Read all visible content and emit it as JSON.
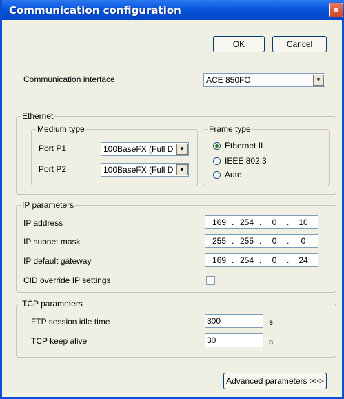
{
  "window": {
    "title": "Communication configuration",
    "close_glyph": "×"
  },
  "buttons": {
    "ok": "OK",
    "cancel": "Cancel",
    "advanced": "Advanced parameters >>>"
  },
  "comm_interface": {
    "label": "Communication interface",
    "value": "ACE 850FO"
  },
  "ethernet": {
    "title": "Ethernet",
    "medium_type": {
      "title": "Medium type",
      "port_p1": {
        "label": "Port P1",
        "value": "100BaseFX (Full D"
      },
      "port_p2": {
        "label": "Port P2",
        "value": "100BaseFX (Full D"
      }
    },
    "frame_type": {
      "title": "Frame type",
      "options": [
        "Ethernet II",
        "IEEE 802.3",
        "Auto"
      ],
      "selected": "Ethernet II"
    }
  },
  "ip": {
    "title": "IP parameters",
    "address": {
      "label": "IP address",
      "octets": [
        "169",
        "254",
        "0",
        "10"
      ]
    },
    "subnet": {
      "label": "IP subnet mask",
      "octets": [
        "255",
        "255",
        "0",
        "0"
      ]
    },
    "gateway": {
      "label": "IP default gateway",
      "octets": [
        "169",
        "254",
        "0",
        "24"
      ]
    },
    "cid_override": {
      "label": "CID override IP settings",
      "checked": false
    }
  },
  "tcp": {
    "title": "TCP parameters",
    "ftp_idle": {
      "label": "FTP session idle time",
      "value": "300",
      "unit": "s"
    },
    "keep_alive": {
      "label": "TCP keep alive",
      "value": "30",
      "unit": "s"
    }
  },
  "colors": {
    "title_bar": "#0a58e0",
    "dialog_bg": "#f0efe4",
    "close_button": "#d0452a"
  }
}
